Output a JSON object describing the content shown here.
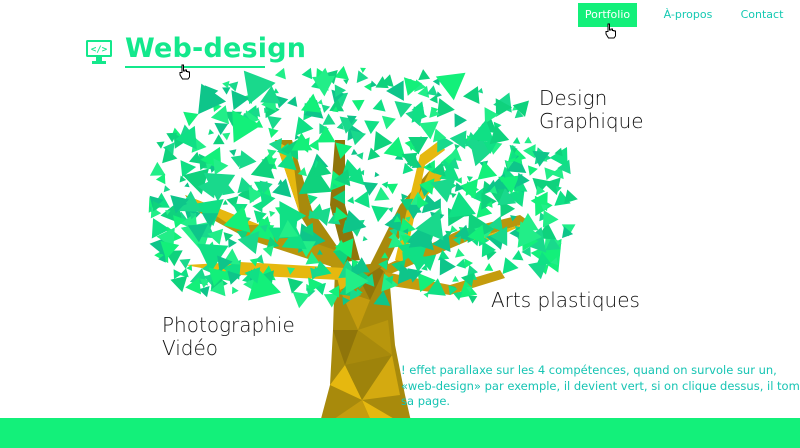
{
  "nav": {
    "items": [
      {
        "label": "Portfolio",
        "active": true
      },
      {
        "label": "À-propos",
        "active": false
      },
      {
        "label": "Contact",
        "active": false
      }
    ]
  },
  "brand": {
    "title": "Web-design",
    "icon": "monitor-code-icon"
  },
  "skills": {
    "design": [
      "Design",
      "Graphique"
    ],
    "arts": "Arts plastiques",
    "photo": [
      "Photographie",
      "Vidéo"
    ]
  },
  "note": {
    "lines": [
      "! effet parallaxe sur les 4 compétences, quand on survole sur un,",
      "«web-design» par exemple, il devient vert, si on clique dessus, il tombe s",
      "sa page."
    ]
  },
  "colors": {
    "accent": "#13f07a",
    "leaf_dark": "#0ec58a",
    "trunk": "#a88a0c",
    "trunk_light": "#e6b80f",
    "teal_text": "#16c4b3"
  }
}
